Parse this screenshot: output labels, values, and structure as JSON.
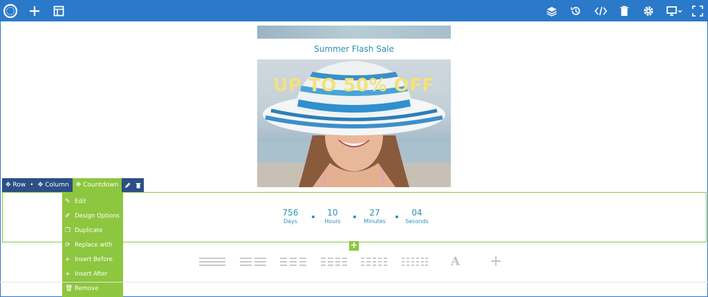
{
  "toolbar": {
    "left_icons": [
      "logo-icon",
      "add-icon",
      "layout-icon"
    ],
    "right_icons": [
      "layers-icon",
      "history-icon",
      "code-icon",
      "trash-icon",
      "settings-icon",
      "device-icon",
      "fullscreen-icon"
    ]
  },
  "content": {
    "title": "Summer Flash Sale",
    "banner_text": "UP TO 50% OFF"
  },
  "countdown": {
    "units": [
      {
        "value": "756",
        "label": "Days"
      },
      {
        "value": "10",
        "label": "Hours"
      },
      {
        "value": "27",
        "label": "Minutes"
      },
      {
        "value": "04",
        "label": "Seconds"
      }
    ]
  },
  "breadcrumb": {
    "row": "Row",
    "column": "Column",
    "element": "Countdown"
  },
  "context_menu": {
    "items": [
      "Edit",
      "Design Options",
      "Duplicate",
      "Replace with",
      "Insert Before",
      "Insert After",
      "Remove"
    ]
  },
  "colors": {
    "toolbar": "#2b79c9",
    "accent_green": "#8dc63f",
    "crumb_blue": "#2c4f86",
    "text_teal": "#2a8fb8",
    "banner_yellow": "#f3e27a"
  }
}
